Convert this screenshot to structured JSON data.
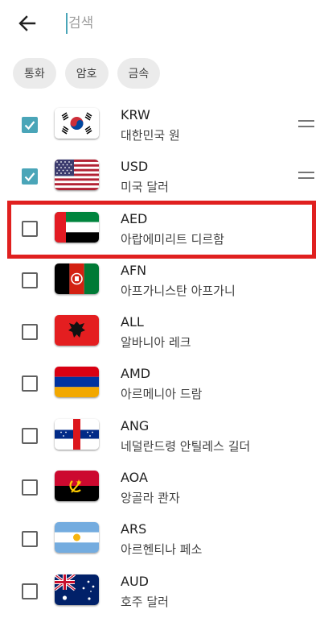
{
  "search": {
    "placeholder": "검색"
  },
  "chips": [
    "통화",
    "암호",
    "금속"
  ],
  "accent_color": "#4aa5b8",
  "highlight_color": "#e0201f",
  "currencies": [
    {
      "code": "KRW",
      "name": "대한민국 원",
      "checked": true,
      "flag": "south-korea-flag",
      "draggable": true
    },
    {
      "code": "USD",
      "name": "미국 달러",
      "checked": true,
      "flag": "usa-flag",
      "draggable": true
    },
    {
      "code": "AED",
      "name": "아랍에미리트 디르함",
      "checked": false,
      "flag": "uae-flag",
      "highlighted": true
    },
    {
      "code": "AFN",
      "name": "아프가니스탄 아프가니",
      "checked": false,
      "flag": "afghanistan-flag"
    },
    {
      "code": "ALL",
      "name": "알바니아 레크",
      "checked": false,
      "flag": "albania-flag"
    },
    {
      "code": "AMD",
      "name": "아르메니아 드람",
      "checked": false,
      "flag": "armenia-flag"
    },
    {
      "code": "ANG",
      "name": "네덜란드령 안틸레스 길더",
      "checked": false,
      "flag": "netherlands-antilles-flag"
    },
    {
      "code": "AOA",
      "name": "앙골라 콴자",
      "checked": false,
      "flag": "angola-flag"
    },
    {
      "code": "ARS",
      "name": "아르헨티나 페소",
      "checked": false,
      "flag": "argentina-flag"
    },
    {
      "code": "AUD",
      "name": "호주 달러",
      "checked": false,
      "flag": "australia-flag"
    }
  ]
}
